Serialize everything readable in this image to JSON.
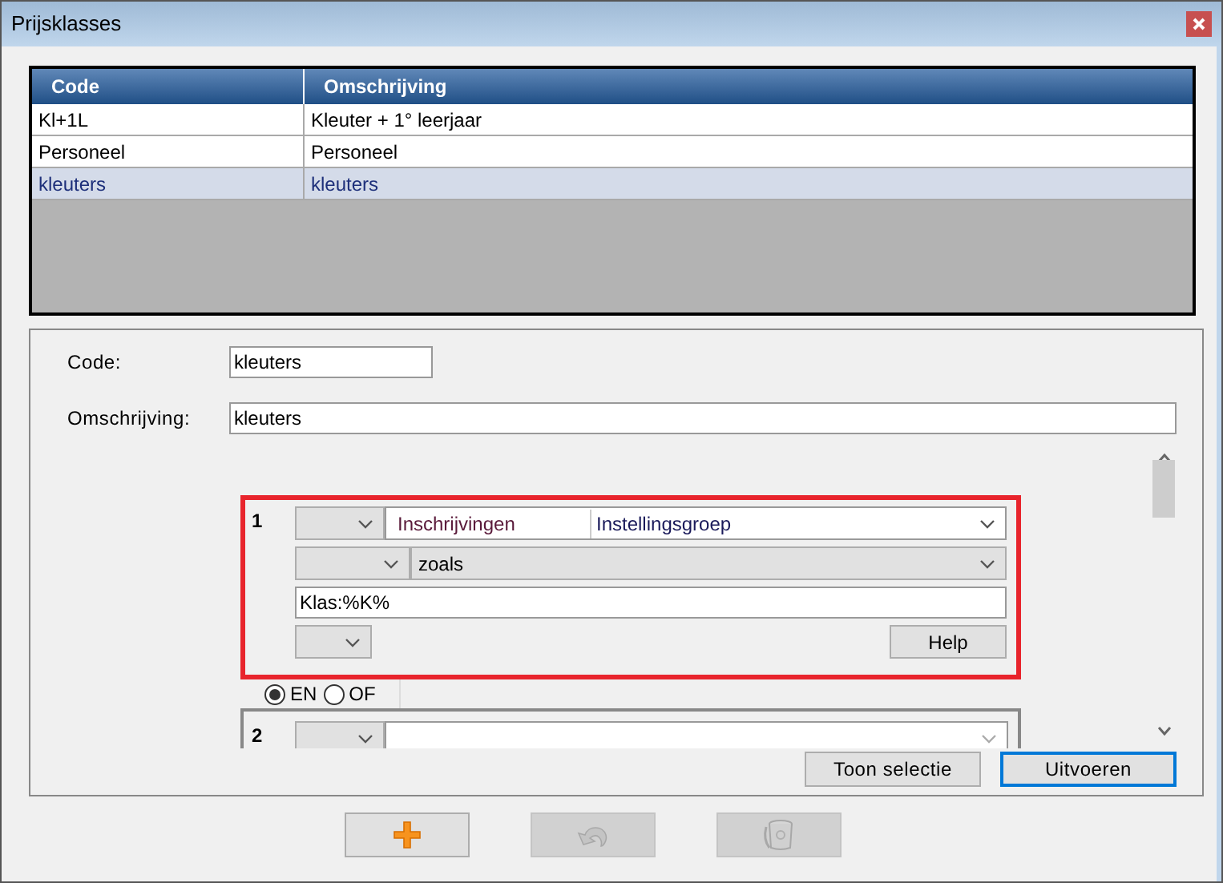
{
  "window": {
    "title": "Prijsklasses"
  },
  "table": {
    "columns": [
      "Code",
      "Omschrijving"
    ],
    "rows": [
      {
        "cells": [
          "Kl+1L",
          "Kleuter + 1° leerjaar"
        ],
        "selected": false
      },
      {
        "cells": [
          "Personeel",
          "Personeel"
        ],
        "selected": false
      },
      {
        "cells": [
          "kleuters",
          "kleuters"
        ],
        "selected": true
      }
    ]
  },
  "form": {
    "fields": [
      {
        "label": "Code:",
        "value": "kleuters",
        "kind": "short"
      },
      {
        "label": "Omschrijving:",
        "value": "kleuters",
        "kind": "long"
      }
    ]
  },
  "conditions": [
    {
      "number": "1",
      "highlighted": true,
      "table": "Inschrijvingen",
      "field": "Instellingsgroep",
      "operator": "zoals",
      "value": "Klas:%K%",
      "help": "Help"
    },
    {
      "number": "2",
      "highlighted": false
    }
  ],
  "connector": [
    {
      "label": "EN",
      "selected": true
    },
    {
      "label": "OF",
      "selected": false
    }
  ],
  "actions": [
    {
      "label": "Toon selectie",
      "focused": false
    },
    {
      "label": "Uitvoeren",
      "focused": true
    }
  ],
  "toolbar": [
    {
      "kind": "add",
      "disabled": false
    },
    {
      "kind": "undo",
      "disabled": true
    },
    {
      "kind": "delete",
      "disabled": true
    }
  ]
}
